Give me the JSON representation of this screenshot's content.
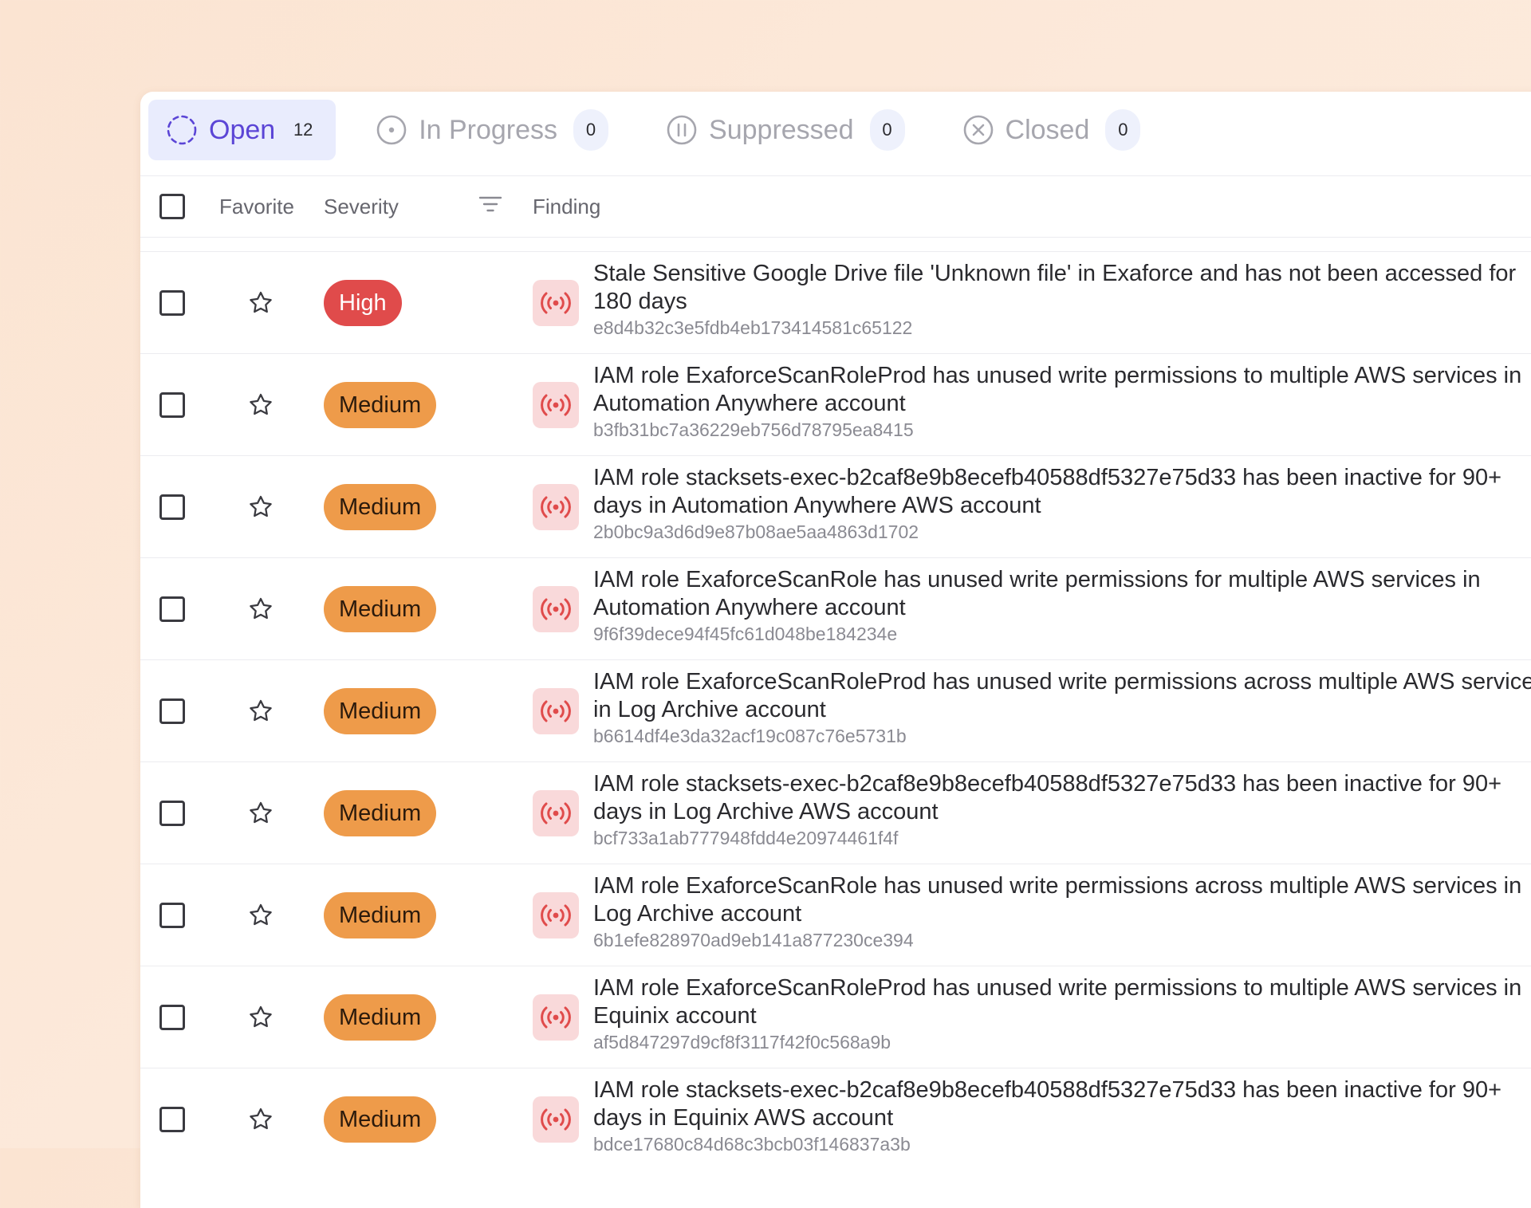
{
  "tabs": [
    {
      "label": "Open",
      "count": "12",
      "icon": "dashed-circle-icon"
    },
    {
      "label": "In Progress",
      "count": "0",
      "icon": "dot-circle-icon"
    },
    {
      "label": "Suppressed",
      "count": "0",
      "icon": "pause-circle-icon"
    },
    {
      "label": "Closed",
      "count": "0",
      "icon": "x-circle-icon"
    }
  ],
  "header": {
    "favorite": "Favorite",
    "severity": "Severity",
    "finding": "Finding",
    "filter_icon": "filter-icon"
  },
  "colors": {
    "accent": "#5b45d6",
    "high": "#e04b4b",
    "medium": "#ee9b4a",
    "signal_bg": "#f9d9da",
    "signal_fg": "#e04b4b"
  },
  "rows": [
    {
      "severity": "High",
      "title": "Stale Sensitive Google Drive file 'Unknown file' in Exaforce and has not been accessed for 180 days",
      "id": "e8d4b32c3e5fdb4eb173414581c65122"
    },
    {
      "severity": "Medium",
      "title": "IAM role ExaforceScanRoleProd has unused write permissions to multiple AWS services in Automation Anywhere account",
      "id": "b3fb31bc7a36229eb756d78795ea8415"
    },
    {
      "severity": "Medium",
      "title": "IAM role stacksets-exec-b2caf8e9b8ecefb40588df5327e75d33 has been inactive for 90+ days in Automation Anywhere AWS account",
      "id": "2b0bc9a3d6d9e87b08ae5aa4863d1702"
    },
    {
      "severity": "Medium",
      "title": "IAM role ExaforceScanRole has unused write permissions for multiple AWS services in Automation Anywhere account",
      "id": "9f6f39dece94f45fc61d048be184234e"
    },
    {
      "severity": "Medium",
      "title": "IAM role ExaforceScanRoleProd has unused write permissions across multiple AWS services in Log Archive account",
      "id": "b6614df4e3da32acf19c087c76e5731b"
    },
    {
      "severity": "Medium",
      "title": "IAM role stacksets-exec-b2caf8e9b8ecefb40588df5327e75d33 has been inactive for 90+ days in Log Archive AWS account",
      "id": "bcf733a1ab777948fdd4e20974461f4f"
    },
    {
      "severity": "Medium",
      "title": "IAM role ExaforceScanRole has unused write permissions across multiple AWS services in Log Archive account",
      "id": "6b1efe828970ad9eb141a877230ce394"
    },
    {
      "severity": "Medium",
      "title": "IAM role ExaforceScanRoleProd has unused write permissions to multiple AWS services in Equinix account",
      "id": "af5d847297d9cf8f3117f42f0c568a9b"
    },
    {
      "severity": "Medium",
      "title": "IAM role stacksets-exec-b2caf8e9b8ecefb40588df5327e75d33 has been inactive for 90+ days in Equinix AWS account",
      "id": "bdce17680c84d68c3bcb03f146837a3b"
    }
  ]
}
